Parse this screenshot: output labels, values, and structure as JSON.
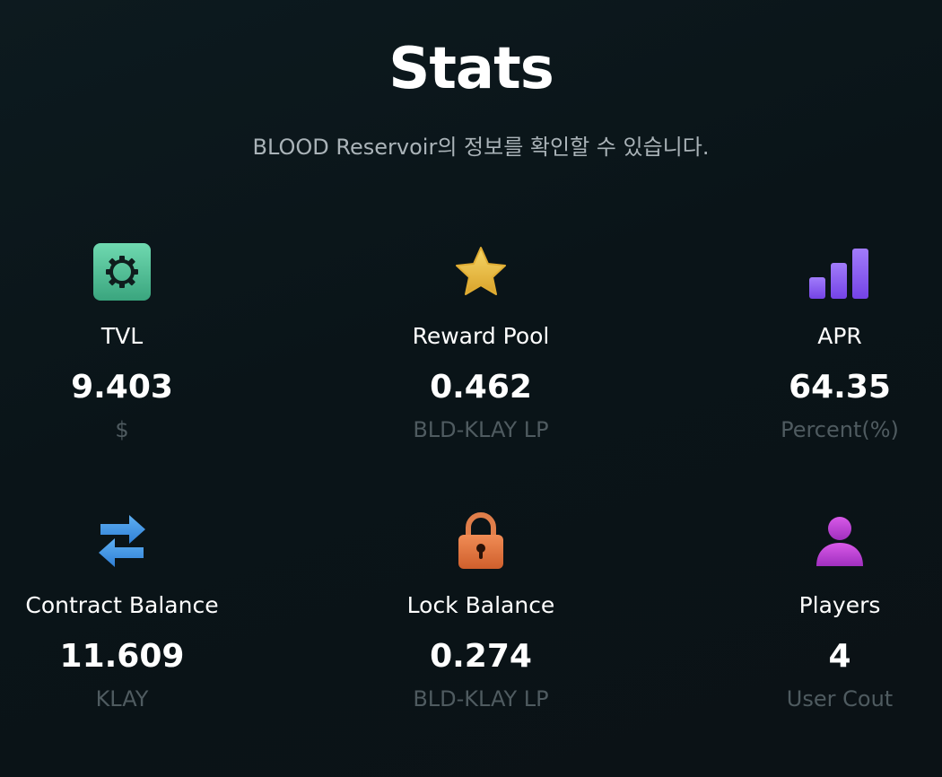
{
  "header": {
    "title": "Stats",
    "subtitle": "BLOOD Reservoir의 정보를 확인할 수 있습니다."
  },
  "stats": [
    {
      "icon": "gear-icon",
      "label": "TVL",
      "value": "9.403",
      "unit": "$"
    },
    {
      "icon": "star-icon",
      "label": "Reward Pool",
      "value": "0.462",
      "unit": "BLD-KLAY LP"
    },
    {
      "icon": "bar-chart-icon",
      "label": "APR",
      "value": "64.35",
      "unit": "Percent(%)"
    },
    {
      "icon": "transfer-arrows-icon",
      "label": "Contract Balance",
      "value": "11.609",
      "unit": "KLAY"
    },
    {
      "icon": "lock-icon",
      "label": "Lock Balance",
      "value": "0.274",
      "unit": "BLD-KLAY LP"
    },
    {
      "icon": "user-icon",
      "label": "Players",
      "value": "4",
      "unit": "User Cout"
    }
  ],
  "colors": {
    "background": "#0b1519",
    "label_text": "#ffffff",
    "unit_text": "#4f5b60",
    "subtitle_text": "#aab3b8",
    "gear_tile": "#4fc49a",
    "star": "#f2c53d",
    "bars": "#8b5cf6",
    "arrows": "#3b8fe0",
    "lock": "#e0763f",
    "user": "#b83fd1"
  }
}
